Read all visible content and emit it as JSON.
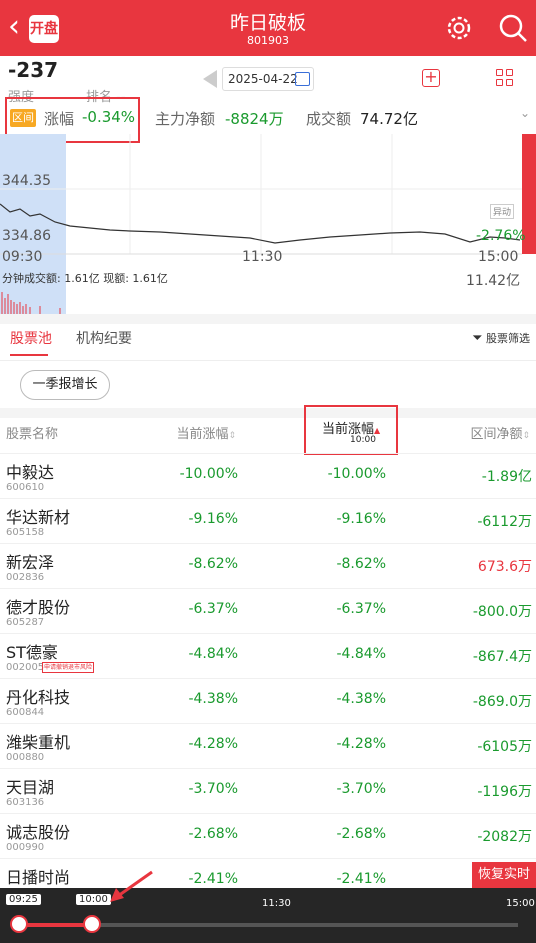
{
  "header": {
    "back": "‹",
    "badge": "开盘",
    "title": "昨日破板",
    "code": "801903"
  },
  "stats": {
    "strength_value": "-237",
    "strength_label": "强度",
    "rank_label": "排名 --",
    "date": "2025-04-22",
    "interval_tag": "区间",
    "change_label": "涨幅",
    "change_value": "-0.34%",
    "net_label": "主力净额",
    "net_value": "-8824万",
    "volume_label": "成交额",
    "volume_value": "74.72亿"
  },
  "chart": {
    "price_high": "344.35",
    "price_low": "334.86",
    "pct_right": "-2.76%",
    "time_start": "09:30",
    "time_mid": "11:30",
    "time_end": "15:00",
    "vol_line": "分钟成交额: 1.61亿  现额: 1.61亿",
    "vol_right": "11.42亿",
    "alert_badge": "异动"
  },
  "tabs": {
    "pool": "股票池",
    "notes": "机构纪要",
    "filter": "股票筛选"
  },
  "chip": "一季报增长",
  "table": {
    "headers": {
      "name": "股票名称",
      "change": "当前涨幅",
      "current": "当前涨幅",
      "current_time": "10:00",
      "net": "区间净额"
    },
    "rows": [
      {
        "name": "中毅达",
        "code": "600610",
        "change": "-10.00%",
        "current": "-10.00%",
        "net": "-1.89亿",
        "net_sign": "neg"
      },
      {
        "name": "华达新材",
        "code": "605158",
        "change": "-9.16%",
        "current": "-9.16%",
        "net": "-6112万",
        "net_sign": "neg"
      },
      {
        "name": "新宏泽",
        "code": "002836",
        "change": "-8.62%",
        "current": "-8.62%",
        "net": "673.6万",
        "net_sign": "pos"
      },
      {
        "name": "德才股份",
        "code": "605287",
        "change": "-6.37%",
        "current": "-6.37%",
        "net": "-800.0万",
        "net_sign": "neg"
      },
      {
        "name": "ST德豪",
        "code": "002005",
        "tag": "申请撤销退市风险",
        "change": "-4.84%",
        "current": "-4.84%",
        "net": "-867.4万",
        "net_sign": "neg"
      },
      {
        "name": "丹化科技",
        "code": "600844",
        "change": "-4.38%",
        "current": "-4.38%",
        "net": "-869.0万",
        "net_sign": "neg"
      },
      {
        "name": "潍柴重机",
        "code": "000880",
        "change": "-4.28%",
        "current": "-4.28%",
        "net": "-6105万",
        "net_sign": "neg"
      },
      {
        "name": "天目湖",
        "code": "603136",
        "change": "-3.70%",
        "current": "-3.70%",
        "net": "-1196万",
        "net_sign": "neg"
      },
      {
        "name": "诚志股份",
        "code": "000990",
        "change": "-2.68%",
        "current": "-2.68%",
        "net": "-2082万",
        "net_sign": "neg"
      },
      {
        "name": "日播时尚",
        "code": "603196",
        "change": "-2.41%",
        "current": "-2.41%",
        "net": "",
        "net_sign": "neg"
      }
    ]
  },
  "restore_button": "恢复实时",
  "timeline": {
    "start": "09:25",
    "current": "10:00",
    "mid": "11:30",
    "end": "15:00"
  },
  "colors": {
    "brand": "#e8363f",
    "down": "#1a9a2e",
    "tag": "#f7a823"
  }
}
